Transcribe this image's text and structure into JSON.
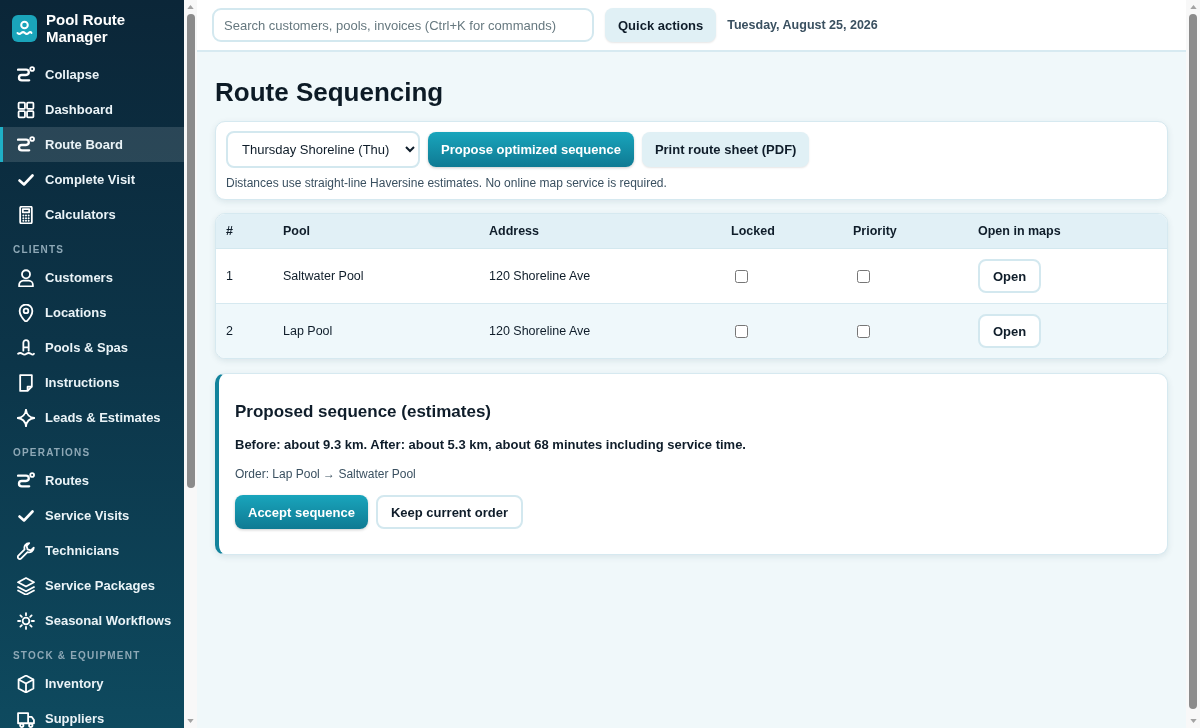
{
  "sidebar": {
    "brand": "Pool Route Manager",
    "groups": [
      {
        "items": [
          {
            "label": "Collapse",
            "selected": false
          },
          {
            "label": "Dashboard",
            "selected": false
          },
          {
            "label": "Route Board",
            "selected": true
          },
          {
            "label": "Complete Visit",
            "selected": false
          },
          {
            "label": "Calculators",
            "selected": false
          }
        ]
      },
      {
        "heading": "CLIENTS",
        "items": [
          {
            "label": "Customers",
            "selected": false
          },
          {
            "label": "Locations",
            "selected": false
          },
          {
            "label": "Pools & Spas",
            "selected": false
          },
          {
            "label": "Instructions",
            "selected": false
          },
          {
            "label": "Leads & Estimates",
            "selected": false
          }
        ]
      },
      {
        "heading": "OPERATIONS",
        "items": [
          {
            "label": "Routes",
            "selected": false
          },
          {
            "label": "Service Visits",
            "selected": false
          },
          {
            "label": "Technicians",
            "selected": false
          },
          {
            "label": "Service Packages",
            "selected": false
          },
          {
            "label": "Seasonal Workflows",
            "selected": false
          }
        ]
      },
      {
        "heading": "STOCK & EQUIPMENT",
        "items": [
          {
            "label": "Inventory",
            "selected": false
          },
          {
            "label": "Suppliers",
            "selected": false
          }
        ]
      }
    ]
  },
  "top_bar": {
    "search": {
      "placeholder": "Search customers, pools, invoices (Ctrl+K for commands)"
    },
    "button": {
      "label": "Quick actions",
      "kind": "secondary"
    },
    "date": "Tuesday, August 25, 2026"
  },
  "page": {
    "title": "Route Sequencing"
  },
  "controls": {
    "route_select": {
      "value": "Thursday Shoreline (Thu)"
    },
    "buttons": [
      {
        "label": "Propose optimized sequence",
        "kind": "primary"
      },
      {
        "label": "Print route sheet (PDF)",
        "kind": "secondary"
      }
    ],
    "note": "Distances use straight-line Haversine estimates. No online map service is required."
  },
  "table": {
    "columns": [
      "#",
      "Pool",
      "Address",
      "Locked",
      "Priority",
      "Open in maps"
    ],
    "rows": [
      {
        "number": "1",
        "pool": "Saltwater Pool",
        "address": "120 Shoreline Ave",
        "locked": false,
        "priority": false,
        "action": "Open"
      },
      {
        "number": "2",
        "pool": "Lap Pool",
        "address": "120 Shoreline Ave",
        "locked": false,
        "priority": false,
        "action": "Open"
      }
    ]
  },
  "proposal": {
    "title": "Proposed sequence (estimates)",
    "summary": "Before: about 9.3 km. After: about 5.3 km, about 68 minutes including service time.",
    "order": "Order: Lap Pool → Saltwater Pool",
    "buttons": [
      {
        "label": "Accept sequence",
        "kind": "primary"
      },
      {
        "label": "Keep current order",
        "kind": "outline"
      }
    ]
  }
}
